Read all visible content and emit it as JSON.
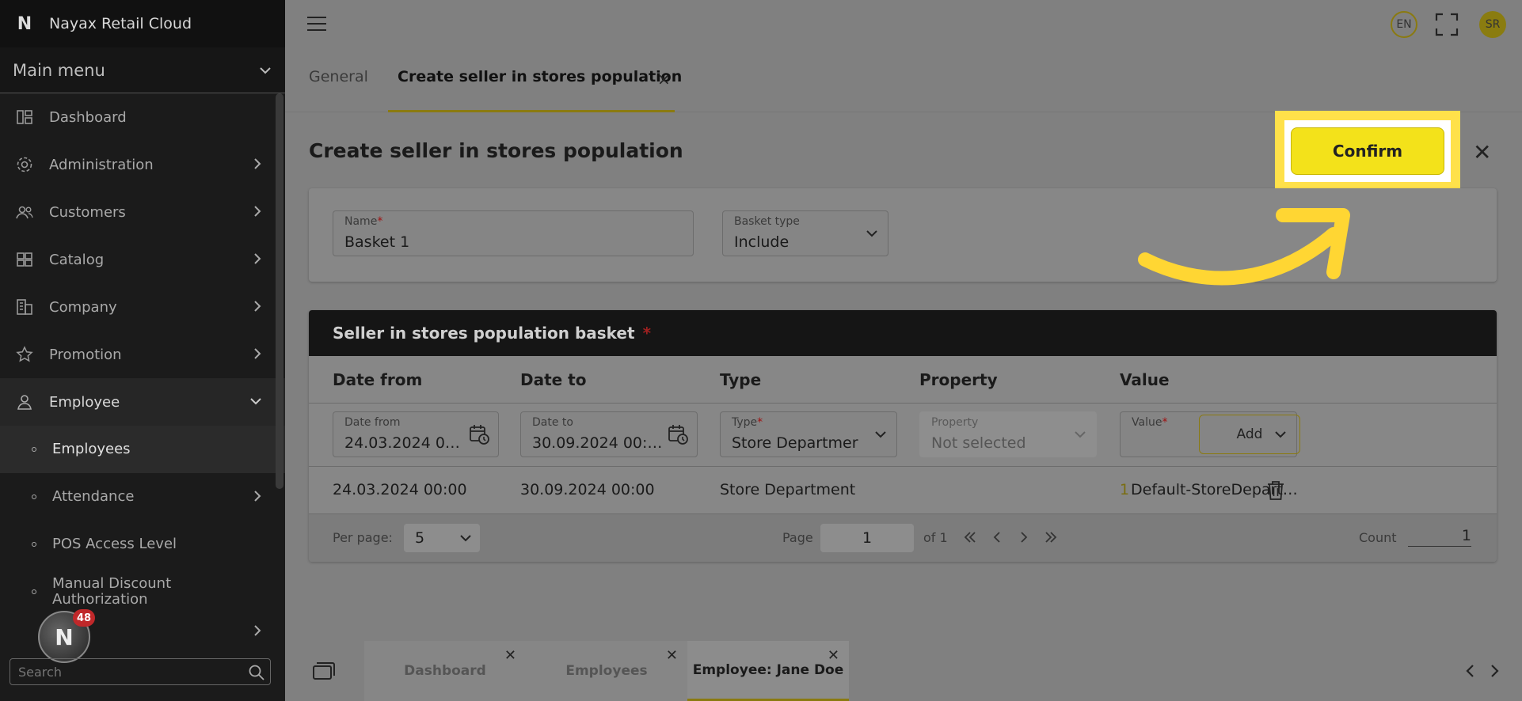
{
  "app": {
    "title": "Nayax Retail Cloud",
    "logo": "N"
  },
  "sidebar": {
    "main_menu_label": "Main menu",
    "items": [
      {
        "label": "Dashboard"
      },
      {
        "label": "Administration"
      },
      {
        "label": "Customers"
      },
      {
        "label": "Catalog"
      },
      {
        "label": "Company"
      },
      {
        "label": "Promotion"
      },
      {
        "label": "Employee"
      }
    ],
    "sub_items": [
      {
        "label": "Employees"
      },
      {
        "label": "Attendance"
      },
      {
        "label": "POS Access Level"
      },
      {
        "label": "Manual Discount Authorization"
      }
    ],
    "search_placeholder": "Search",
    "notification_count": "48"
  },
  "header": {
    "language": "EN",
    "user_initials": "SR"
  },
  "tabs": [
    {
      "label": "General"
    },
    {
      "label": "Create seller in stores population"
    }
  ],
  "page": {
    "title": "Create seller in stores population",
    "confirm_label": "Confirm",
    "name_label": "Name",
    "name_value": "Basket 1",
    "basket_type_label": "Basket type",
    "basket_type_value": "Include"
  },
  "basket": {
    "title": "Seller in stores population basket",
    "columns": [
      "Date from",
      "Date to",
      "Type",
      "Property",
      "Value"
    ],
    "filter": {
      "date_from_label": "Date from",
      "date_from_value": "24.03.2024 0…",
      "date_to_label": "Date to",
      "date_to_value": "30.09.2024 00:…",
      "type_label": "Type",
      "type_value": "Store Departmer",
      "property_label": "Property",
      "property_value": "Not selected",
      "value_label": "Value",
      "add_label": "Add"
    },
    "rows": [
      {
        "date_from": "24.03.2024 00:00",
        "date_to": "30.09.2024 00:00",
        "type": "Store Department",
        "value_count": "1",
        "value": "Default-StoreDepart…"
      }
    ],
    "pager": {
      "per_page_label": "Per page:",
      "per_page_value": "5",
      "page_label": "Page",
      "page_value": "1",
      "of_label": "of 1",
      "count_label": "Count",
      "count_value": "1"
    }
  },
  "bottom_tabs": [
    {
      "label": "Dashboard"
    },
    {
      "label": "Employees"
    },
    {
      "label": "Employee: Jane Doe"
    }
  ],
  "colors": {
    "accent": "#f3e21a",
    "highlight": "#ffe14a",
    "sidebar": "#1b1b1b"
  }
}
